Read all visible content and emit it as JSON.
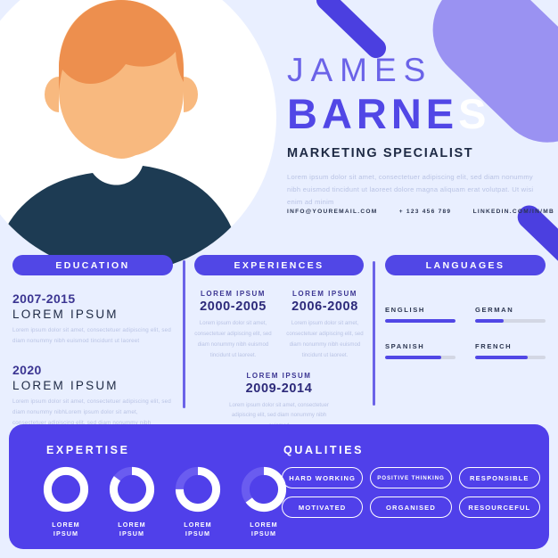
{
  "header": {
    "first_name": "JAMES",
    "last_name_main": "BARNE",
    "last_name_tail": "S",
    "job_title": "MARKETING SPECIALIST",
    "bio": "Lorem ipsum dolor sit amet, consectetuer adipiscing elit, sed diam nonummy nibh euismod tincidunt ut laoreet dolore magna aliquam erat volutpat. Ut wisi enim ad minim",
    "contact": {
      "email": "INFO@YOUREMAIL.COM",
      "phone": "+ 123 456 789",
      "linkedin": "LINKEDIN.COM/IN/MB"
    }
  },
  "education": {
    "title": "EDUCATION",
    "entries": [
      {
        "years": "2007-2015",
        "institution": "LOREM IPSUM",
        "description": "Lorem ipsum dolor sit amet, consectetuer adipiscing elit, sed diam nonummy nibh euismod tincidunt ut laoreet"
      },
      {
        "years": "2020",
        "institution": "LOREM IPSUM",
        "description": "Lorem ipsum dolor sit amet, consectetuer adipiscing elit, sed diam nonummy nibhLorem ipsum dolor sit amet, consectetuer adipiscing elit, sed diam nonummy nibh"
      }
    ]
  },
  "experiences": {
    "title": "EXPERIENCES",
    "entries": [
      {
        "label": "LOREM IPSUM",
        "years": "2000-2005",
        "description": "Lorem ipsum dolor sit amet, consectetuer adipiscing elit, sed diam nonummy nibh euismod tincidunt ut laoreet."
      },
      {
        "label": "LOREM IPSUM",
        "years": "2006-2008",
        "description": "Lorem ipsum dolor sit amet, consectetuer adipiscing elit, sed diam nonummy nibh euismod tincidunt ut laoreet."
      },
      {
        "label": "LOREM IPSUM",
        "years": "2009-2014",
        "description": "Lorem ipsum dolor sit amet, consectetuer adipiscing elit, sed diam nonummy nibh euismod"
      }
    ]
  },
  "languages": {
    "title": "LANGUAGES",
    "items": [
      {
        "name": "ENGLISH",
        "level": 100
      },
      {
        "name": "GERMAN",
        "level": 40
      },
      {
        "name": "SPANISH",
        "level": 80
      },
      {
        "name": "FRENCH",
        "level": 75
      }
    ]
  },
  "expertise": {
    "title": "EXPERTISE",
    "items": [
      {
        "label": "LOREM\nIPSUM",
        "percent": 100
      },
      {
        "label": "LOREM\nIPSUM",
        "percent": 85
      },
      {
        "label": "LOREM\nIPSUM",
        "percent": 75
      },
      {
        "label": "LOREM\nIPSUM",
        "percent": 65
      }
    ]
  },
  "qualities": {
    "title": "QUALITIES",
    "items": [
      "HARD WORKING",
      "POSITIVE THINKING",
      "RESPONSIBLE",
      "MOTIVATED",
      "ORGANISED",
      "RESOURCEFUL"
    ]
  },
  "colors": {
    "background": "#e9efff",
    "accent": "#5147e6",
    "accent_light": "#9a92f2",
    "accent_deep": "#5040ea",
    "panel_text": "#ffffff",
    "muted_text": "#b9c3e4",
    "dark_text": "#1e2a44",
    "hair": "#ed8f4e",
    "skin": "#f8b97f",
    "shirt": "#1d3b53"
  }
}
